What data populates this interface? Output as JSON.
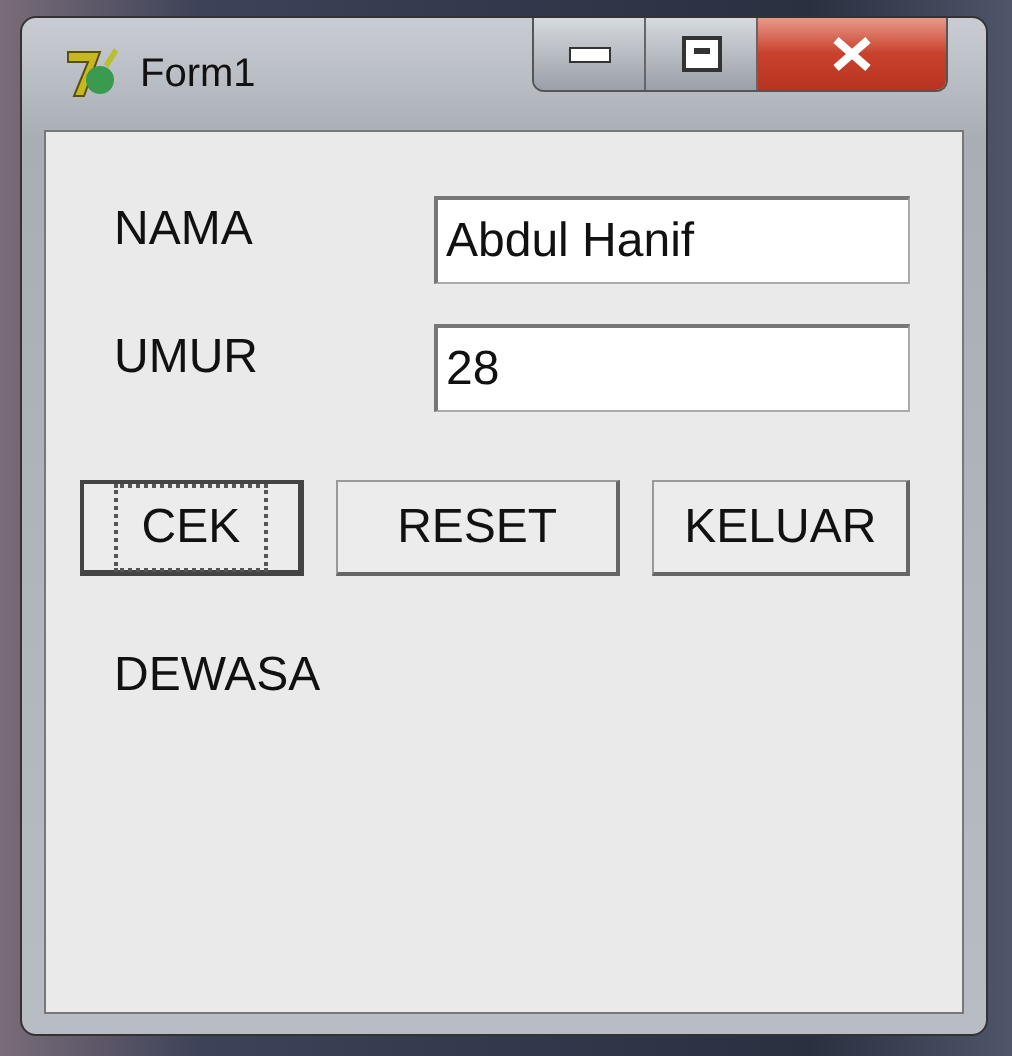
{
  "window": {
    "title": "Form1"
  },
  "fields": [
    {
      "label": "NAMA",
      "value": "Abdul Hanif"
    },
    {
      "label": "UMUR",
      "value": "28"
    }
  ],
  "buttons": [
    {
      "label": "CEK",
      "focused": true
    },
    {
      "label": "RESET",
      "focused": false
    },
    {
      "label": "KELUAR",
      "focused": false
    }
  ],
  "result": "DEWASA"
}
